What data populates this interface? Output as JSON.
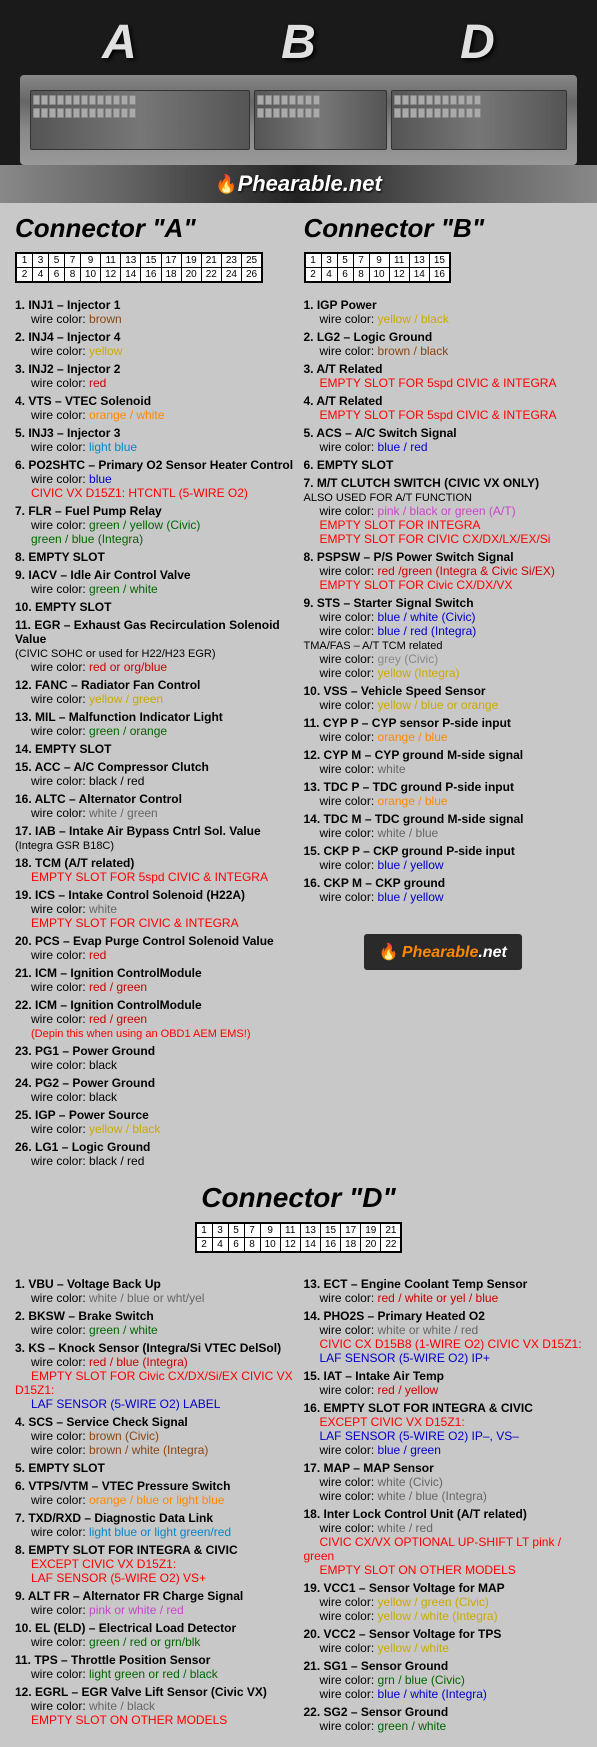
{
  "header": {
    "labels": [
      "A",
      "B",
      "D"
    ],
    "logo": "Phearable",
    "logo_suffix": ".net"
  },
  "connectorA": {
    "title": "Connector \"A\"",
    "pins_row1": [
      "1",
      "3",
      "5",
      "7",
      "9",
      "11",
      "13",
      "15",
      "17",
      "19",
      "21",
      "23",
      "25"
    ],
    "pins_row2": [
      "2",
      "4",
      "6",
      "8",
      "10",
      "12",
      "14",
      "16",
      "18",
      "20",
      "22",
      "24",
      "26"
    ],
    "items": [
      {
        "num": "1.",
        "label": "INJ1 – Injector 1",
        "wire_label": "wire color:",
        "wire_color": "brown",
        "wire_color_class": "wire-brown"
      },
      {
        "num": "2.",
        "label": "INJ4 – Injector 4",
        "wire_label": "wire color:",
        "wire_color": "yellow",
        "wire_color_class": "wire-yellow"
      },
      {
        "num": "3.",
        "label": "INJ2 – Injector 2",
        "wire_label": "wire color:",
        "wire_color": "red",
        "wire_color_class": "wire-red"
      },
      {
        "num": "4.",
        "label": "VTS – VTEC Solenoid",
        "wire_label": "wire color:",
        "wire_color": "orange / white",
        "wire_color_class": "wire-orange"
      },
      {
        "num": "5.",
        "label": "INJ3 – Injector 3",
        "wire_label": "wire color:",
        "wire_color": "light blue",
        "wire_color_class": "wire-lightblue"
      },
      {
        "num": "6.",
        "label": "PO2SHTC – Primary O2 Sensor Heater Control",
        "wire_label": "wire color:",
        "wire_color": "blue",
        "wire_color_class": "wire-blue",
        "extra": "CIVIC VX D15Z1: HTCNTL (5-WIRE O2)",
        "extra_class": "red-text"
      },
      {
        "num": "7.",
        "label": "FLR – Fuel Pump Relay",
        "wire_label": "wire color:",
        "wire_color": "green / yellow (Civic)",
        "wire_color_class": "wire-green",
        "wire_color2": "green / blue (Integra)",
        "wire_color2_class": "wire-green"
      },
      {
        "num": "8.",
        "label": "EMPTY SLOT",
        "empty": true
      },
      {
        "num": "9.",
        "label": "IACV – Idle Air Control Valve",
        "wire_label": "wire color:",
        "wire_color": "green / white",
        "wire_color_class": "wire-green"
      },
      {
        "num": "10.",
        "label": "EMPTY SLOT",
        "empty": true
      },
      {
        "num": "11.",
        "label": "EGR – Exhaust Gas Recirculation Solenoid Value",
        "sublabel": "(CIVIC SOHC or used for H22/H23 EGR)",
        "wire_label": "wire color:",
        "wire_color": "red or org/blue",
        "wire_color_class": "wire-red"
      },
      {
        "num": "12.",
        "label": "FANC – Radiator Fan Control",
        "wire_label": "wire color:",
        "wire_color": "yellow / green",
        "wire_color_class": "wire-yellow"
      },
      {
        "num": "13.",
        "label": "MIL – Malfunction Indicator Light",
        "wire_label": "wire color:",
        "wire_color": "green / orange",
        "wire_color_class": "wire-green"
      },
      {
        "num": "14.",
        "label": "EMPTY SLOT",
        "empty": true
      },
      {
        "num": "15.",
        "label": "ACC – A/C Compressor Clutch",
        "wire_label": "wire color:",
        "wire_color": "black / red",
        "wire_color_class": "wire-black"
      },
      {
        "num": "16.",
        "label": "ALTC – Alternator Control",
        "wire_label": "wire color:",
        "wire_color": "white / green",
        "wire_color_class": "wire-white"
      },
      {
        "num": "17.",
        "label": "IAB – Intake Air Bypass Cntrl Sol. Value",
        "sublabel": "(Integra GSR B18C)"
      },
      {
        "num": "18.",
        "label": "TCM (A/T related)",
        "extra": "EMPTY SLOT FOR 5spd CIVIC & INTEGRA",
        "extra_class": "red-text"
      },
      {
        "num": "19.",
        "label": "ICS – Intake Control Solenoid (H22A)",
        "wire_label": "wire color:",
        "wire_color": "white",
        "wire_color_class": "wire-white",
        "extra": "EMPTY SLOT FOR CIVIC & INTEGRA",
        "extra_class": "red-text"
      },
      {
        "num": "20.",
        "label": "PCS – Evap Purge Control Solenoid Value",
        "wire_label": "wire color:",
        "wire_color": "red",
        "wire_color_class": "wire-red"
      },
      {
        "num": "21.",
        "label": "ICM – Ignition ControlModule",
        "wire_label": "wire color:",
        "wire_color": "red / green",
        "wire_color_class": "wire-red"
      },
      {
        "num": "22.",
        "label": "ICM – Ignition ControlModule",
        "wire_label": "wire color:",
        "wire_color": "red / green",
        "wire_color_class": "wire-red",
        "extra": "(Depin this when using an OBD1 AEM EMS!)",
        "extra_class": "red-text"
      },
      {
        "num": "23.",
        "label": "PG1 – Power Ground",
        "wire_label": "wire color:",
        "wire_color": "black",
        "wire_color_class": "wire-black"
      },
      {
        "num": "24.",
        "label": "PG2 – Power Ground",
        "wire_label": "wire color:",
        "wire_color": "black",
        "wire_color_class": "wire-black"
      },
      {
        "num": "25.",
        "label": "IGP  – Power Source",
        "wire_label": "wire color:",
        "wire_color": "yellow / black",
        "wire_color_class": "wire-yellow"
      },
      {
        "num": "26.",
        "label": "LG1 – Logic Ground",
        "wire_label": "wire color:",
        "wire_color": "black / red",
        "wire_color_class": "wire-black"
      }
    ]
  },
  "connectorB": {
    "title": "Connector \"B\"",
    "pins_row1": [
      "1",
      "3",
      "5",
      "7",
      "9",
      "11",
      "13",
      "15"
    ],
    "pins_row2": [
      "2",
      "4",
      "6",
      "8",
      "10",
      "12",
      "14",
      "16"
    ],
    "items": [
      {
        "num": "1.",
        "label": "IGP  Power",
        "wire_label": "wire color:",
        "wire_color": "yellow / black",
        "wire_color_class": "wire-yellow"
      },
      {
        "num": "2.",
        "label": "LG2 – Logic Ground",
        "wire_label": "wire color:",
        "wire_color": "brown / black",
        "wire_color_class": "wire-brown"
      },
      {
        "num": "3.",
        "label": "A/T Related",
        "extra": "EMPTY SLOT FOR 5spd CIVIC & INTEGRA",
        "extra_class": "red-text"
      },
      {
        "num": "4.",
        "label": "A/T Related",
        "extra": "EMPTY SLOT FOR 5spd CIVIC & INTEGRA",
        "extra_class": "red-text"
      },
      {
        "num": "5.",
        "label": "ACS – A/C Switch Signal",
        "wire_label": "wire color:",
        "wire_color": "blue / red",
        "wire_color_class": "wire-blue"
      },
      {
        "num": "6.",
        "label": "EMPTY SLOT",
        "empty": true
      },
      {
        "num": "7.",
        "label": "M/T CLUTCH SWITCH (CIVIC VX ONLY)",
        "sublabel": "ALSO USED FOR A/T FUNCTION",
        "wire_label": "wire color:",
        "wire_color": "pink / black or green (A/T)",
        "wire_color_class": "wire-red",
        "extra": "EMPTY SLOT FOR INTEGRA",
        "extra_class": "red-text",
        "extra2": "EMPTY SLOT FOR CIVIC CX/DX/LX/EX/Si",
        "extra2_class": "red-text"
      },
      {
        "num": "8.",
        "label": "PSPSW – P/S Power Switch Signal",
        "wire_label": "wire color:",
        "wire_color": "red /green (Integra & Civic Si/EX)",
        "wire_color_class": "wire-red",
        "extra": "EMPTY SLOT FOR Civic CX/DX/VX",
        "extra_class": "red-text"
      },
      {
        "num": "9.",
        "label": "STS – Starter Signal Switch",
        "wire_label": "wire color:",
        "wire_color": "blue / white (Civic)",
        "wire_color_class": "wire-blue",
        "wire_color2": "wire color: blue / red (Integra)",
        "wire_color2_class": "wire-blue",
        "sublabel2": "TMA/FAS – A/T TCM related",
        "wire_color3": "wire color: grey (Civic)",
        "wire_color3_class": "wire-grey",
        "wire_color4": "wire color: yellow (Integra)",
        "wire_color4_class": "wire-yellow"
      },
      {
        "num": "10.",
        "label": "VSS – Vehicle Speed Sensor",
        "wire_label": "wire color:",
        "wire_color": "yellow / blue or orange",
        "wire_color_class": "wire-yellow"
      },
      {
        "num": "11.",
        "label": "CYP P – CYP sensor P-side input",
        "wire_label": "wire color:",
        "wire_color": "orange / blue",
        "wire_color_class": "wire-orange"
      },
      {
        "num": "12.",
        "label": "CYP M – CYP ground M-side signal",
        "wire_label": "wire color:",
        "wire_color": "white",
        "wire_color_class": "wire-white"
      },
      {
        "num": "13.",
        "label": "TDC P – TDC ground P-side input",
        "wire_label": "wire color:",
        "wire_color": "orange / blue",
        "wire_color_class": "wire-orange"
      },
      {
        "num": "14.",
        "label": "TDC M – TDC ground M-side signal",
        "wire_label": "wire color:",
        "wire_color": "white / blue",
        "wire_color_class": "wire-white"
      },
      {
        "num": "15.",
        "label": "CKP P – CKP ground P-side input",
        "wire_label": "wire color:",
        "wire_color": "blue / yellow",
        "wire_color_class": "wire-blue"
      },
      {
        "num": "16.",
        "label": "CKP M – CKP ground",
        "wire_label": "wire color:",
        "wire_color": "blue / yellow",
        "wire_color_class": "wire-blue"
      }
    ]
  },
  "connectorD": {
    "title": "Connector \"D\"",
    "pins_row1": [
      "1",
      "3",
      "5",
      "7",
      "9",
      "11",
      "13",
      "15",
      "17",
      "19",
      "21"
    ],
    "pins_row2": [
      "2",
      "4",
      "6",
      "8",
      "10",
      "12",
      "14",
      "16",
      "18",
      "20",
      "22"
    ],
    "items_left": [
      {
        "num": "1.",
        "label": "VBU – Voltage Back Up",
        "wire_label": "wire color:",
        "wire_color": "white / blue or wht/yel",
        "wire_color_class": "wire-white"
      },
      {
        "num": "2.",
        "label": "BKSW – Brake Switch",
        "wire_label": "wire color:",
        "wire_color": "green / white",
        "wire_color_class": "wire-green"
      },
      {
        "num": "3.",
        "label": "KS – Knock Sensor (Integra/Si VTEC DelSol)",
        "wire_label": "wire color:",
        "wire_color": "red / blue (Integra)",
        "wire_color_class": "wire-red",
        "extra": "EMPTY SLOT FOR Civic CX/DX/Si/EX CIVIC VX D15Z1:",
        "extra_class": "red-text",
        "extra2": "LAF SENSOR (5-WIRE O2) LABEL",
        "extra2_class": "blue-text"
      },
      {
        "num": "4.",
        "label": "SCS – Service Check Signal",
        "wire_label": "wire color:",
        "wire_color": "brown (Civic)",
        "wire_color_class": "wire-brown",
        "wire_color2": "wire color: brown / white (Integra)",
        "wire_color2_class": "wire-brown"
      },
      {
        "num": "5.",
        "label": "EMPTY SLOT",
        "empty": true
      },
      {
        "num": "6.",
        "label": "VTPS/VTM – VTEC Pressure Switch",
        "wire_label": "wire color:",
        "wire_color": "orange / blue or light blue",
        "wire_color_class": "wire-orange"
      },
      {
        "num": "7.",
        "label": "TXD/RXD – Diagnostic Data Link",
        "wire_label": "wire color:",
        "wire_color": "light blue or light green/red",
        "wire_color_class": "wire-lightblue"
      },
      {
        "num": "8.",
        "label": "EMPTY SLOT FOR INTEGRA & CIVIC",
        "empty": true,
        "sublabel": "EXCEPT CIVIC VX D15Z1:",
        "sublabel_class": "red-text",
        "extra": "LAF SENSOR (5-WIRE O2) VS+",
        "extra_class": "red-text"
      },
      {
        "num": "9.",
        "label": "ALT FR – Alternator FR Charge Signal",
        "wire_label": "wire color:",
        "wire_color": "pink or white / red",
        "wire_color_class": "wire-red"
      },
      {
        "num": "10.",
        "label": "EL (ELD) – Electrical Load Detector",
        "wire_label": "wire color:",
        "wire_color": "green / red or grn/blk",
        "wire_color_class": "wire-green"
      },
      {
        "num": "11.",
        "label": "TPS – Throttle Position Sensor",
        "wire_label": "wire color:",
        "wire_color": "light green or red / black",
        "wire_color_class": "wire-green"
      },
      {
        "num": "12.",
        "label": "EGRL – EGR Valve Lift Sensor (Civic VX)",
        "wire_label": "wire color:",
        "wire_color": "white / black",
        "wire_color_class": "wire-white",
        "extra": "EMPTY SLOT ON OTHER MODELS",
        "extra_class": "red-text"
      }
    ],
    "items_right": [
      {
        "num": "13.",
        "label": "ECT – Engine Coolant Temp Sensor",
        "wire_label": "wire color:",
        "wire_color": "red / white or yel / blue",
        "wire_color_class": "wire-red"
      },
      {
        "num": "14.",
        "label": "PHO2S – Primary Heated O2",
        "wire_label": "wire color:",
        "wire_color": "white or white / red",
        "wire_color_class": "wire-white",
        "extra": "CIVIC CX D15B8 (1-WIRE O2) CIVIC VX D15Z1:",
        "extra_class": "red-text",
        "extra2": "LAF SENSOR (5-WIRE O2) IP+",
        "extra2_class": "blue-text"
      },
      {
        "num": "15.",
        "label": "IAT – Intake Air Temp",
        "wire_label": "wire color:",
        "wire_color": "red / yellow",
        "wire_color_class": "wire-red"
      },
      {
        "num": "16.",
        "label": "EMPTY SLOT FOR INTEGRA & CIVIC",
        "empty": true,
        "sublabel": "EXCEPT CIVIC VX D15Z1:",
        "sublabel_class": "red-text",
        "extra": "LAF SENSOR (5-WIRE O2) IP–, VS–",
        "extra_class": "blue-text",
        "wire_label2": "wire color:",
        "wire_color2": "blue / green",
        "wire_color2_class": "wire-blue"
      },
      {
        "num": "17.",
        "label": "MAP – MAP Sensor",
        "wire_label": "wire color:",
        "wire_color": "white (Civic)",
        "wire_color_class": "wire-white",
        "wire_color2": "wire color: white / blue (Integra)",
        "wire_color2_class": "wire-white"
      },
      {
        "num": "18.",
        "label": "Inter Lock Control Unit (A/T related)",
        "wire_label": "wire color:",
        "wire_color": "white / red",
        "wire_color_class": "wire-white",
        "extra": "CIVIC CX/VX OPTIONAL UP-SHIFT LT  pink / green",
        "extra_class": "red-text",
        "extra2": "EMPTY SLOT ON OTHER MODELS",
        "extra2_class": "red-text"
      },
      {
        "num": "19.",
        "label": "VCC1 – Sensor Voltage for MAP",
        "wire_label": "wire color:",
        "wire_color": "yellow / green (Civic)",
        "wire_color_class": "wire-yellow",
        "wire_color2": "wire color: yellow / white (Integra)",
        "wire_color2_class": "wire-yellow"
      },
      {
        "num": "20.",
        "label": "VCC2 – Sensor Voltage for TPS",
        "wire_label": "wire color:",
        "wire_color": "yellow / white",
        "wire_color_class": "wire-yellow"
      },
      {
        "num": "21.",
        "label": "SG1 – Sensor Ground",
        "wire_label": "wire color:",
        "wire_color": "grn / blue (Civic)",
        "wire_color_class": "wire-green",
        "wire_color2": "wire color: blue / white (Integra)",
        "wire_color2_class": "wire-blue"
      },
      {
        "num": "22.",
        "label": "SG2 – Sensor Ground",
        "wire_label": "wire color:",
        "wire_color": "green / white",
        "wire_color_class": "wire-green"
      }
    ]
  }
}
